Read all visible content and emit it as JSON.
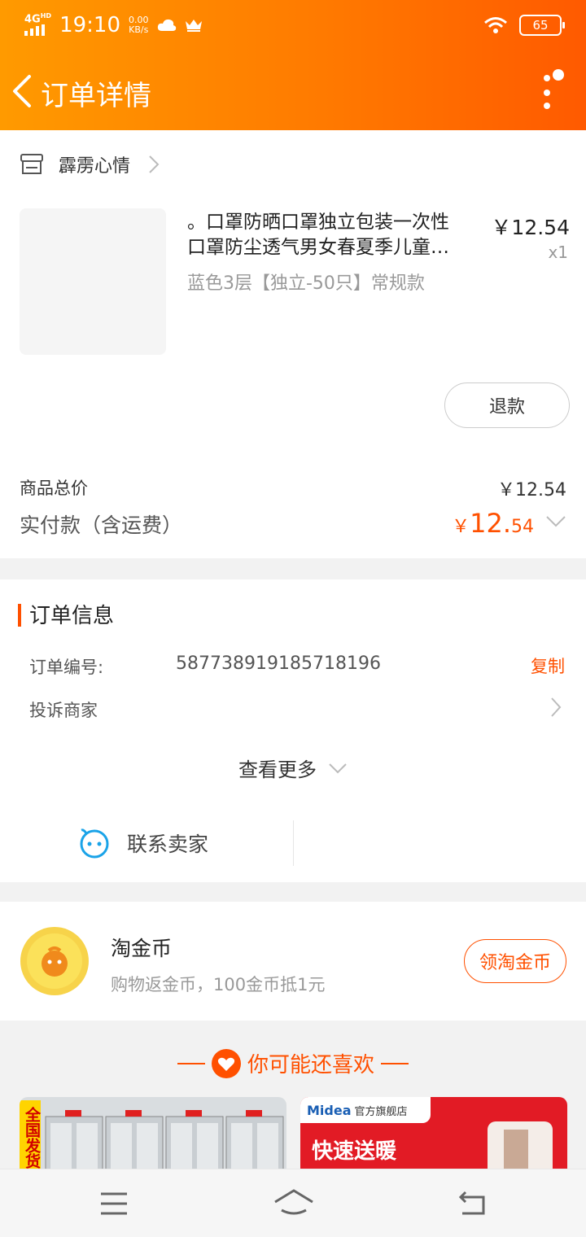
{
  "status_bar": {
    "network": "4G",
    "network_sup": "HD",
    "time": "19:10",
    "speed_value": "0.00",
    "speed_unit": "KB/s",
    "battery": "65"
  },
  "nav": {
    "title": "订单详情"
  },
  "store": {
    "name": "霹雳心情"
  },
  "product": {
    "title_line1": "。口罩防晒口罩独立包装一次性",
    "title_line2": "口罩防尘透气男女春夏季儿童…",
    "price": "￥12.54",
    "qty": "x1",
    "spec": "蓝色3层【独立-50只】常规款",
    "refund_label": "退款"
  },
  "summary": {
    "total_label": "商品总价",
    "total_value": "￥12.54",
    "paid_label": "实付款（含运费）",
    "paid_currency": "￥",
    "paid_int": "12.",
    "paid_dec": "54"
  },
  "order_info": {
    "section_title": "订单信息",
    "order_no_label": "订单编号:",
    "order_no_value": "587738919185718196",
    "copy_label": "复制",
    "complaint_label": "投诉商家",
    "view_more_label": "查看更多",
    "contact_label": "联系卖家"
  },
  "coins": {
    "title": "淘金币",
    "subtitle": "购物返金币，100金币抵1元",
    "button": "领淘金币"
  },
  "recommend": {
    "title": "你可能还喜欢",
    "card1_text": "全国发货",
    "card2_brand": "Midea",
    "card2_store": "官方旗舰店",
    "card2_slogan": "快速送暖"
  },
  "colors": {
    "accent": "#ff5000",
    "header_start": "#ff9a00",
    "header_end": "#ff5a00"
  }
}
